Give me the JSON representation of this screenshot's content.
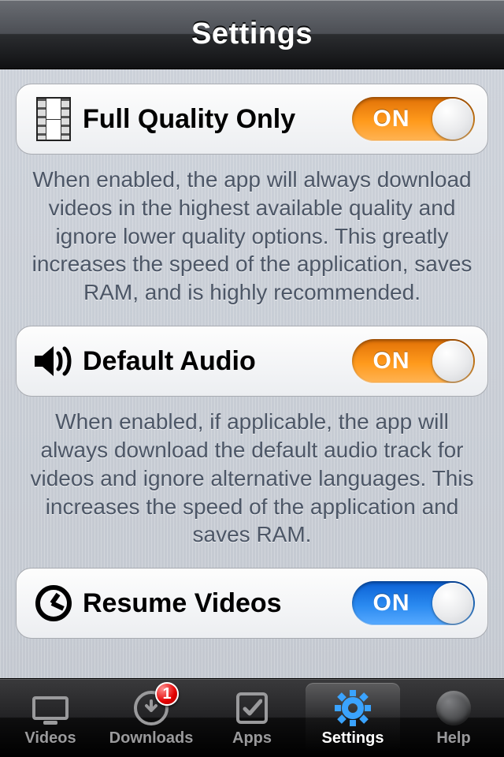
{
  "nav": {
    "title": "Settings"
  },
  "rows": [
    {
      "icon": "film-icon",
      "label": "Full Quality Only",
      "switch": {
        "state": "ON",
        "style": "orange"
      },
      "footer": "When enabled, the app will always download videos in the highest available quality and ignore lower quality options. This greatly increases the speed of the application, saves RAM, and is highly recommended."
    },
    {
      "icon": "speaker-icon",
      "label": "Default Audio",
      "switch": {
        "state": "ON",
        "style": "orange"
      },
      "footer": "When enabled, if applicable, the app will always download the default audio track for videos and ignore alternative languages. This increases the speed of the application and saves RAM."
    },
    {
      "icon": "clock-icon",
      "label": "Resume Videos",
      "switch": {
        "state": "ON",
        "style": "blue"
      }
    }
  ],
  "tabs": [
    {
      "name": "videos",
      "label": "Videos",
      "active": false
    },
    {
      "name": "downloads",
      "label": "Downloads",
      "active": false,
      "badge": "1"
    },
    {
      "name": "apps",
      "label": "Apps",
      "active": false
    },
    {
      "name": "settings",
      "label": "Settings",
      "active": true
    },
    {
      "name": "help",
      "label": "Help",
      "active": false
    }
  ]
}
